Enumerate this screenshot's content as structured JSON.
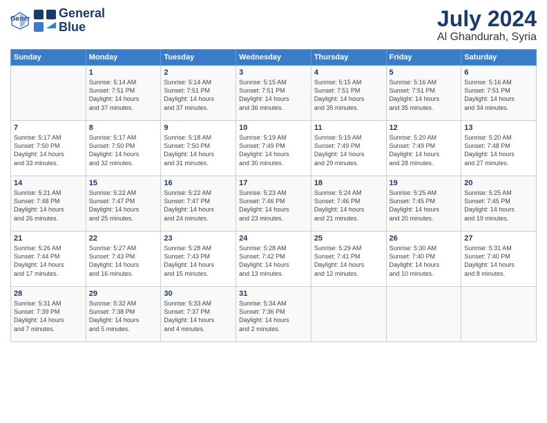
{
  "header": {
    "logo_line1": "General",
    "logo_line2": "Blue",
    "month": "July 2024",
    "location": "Al Ghandurah, Syria"
  },
  "weekdays": [
    "Sunday",
    "Monday",
    "Tuesday",
    "Wednesday",
    "Thursday",
    "Friday",
    "Saturday"
  ],
  "weeks": [
    [
      {
        "day": "",
        "content": ""
      },
      {
        "day": "1",
        "content": "Sunrise: 5:14 AM\nSunset: 7:51 PM\nDaylight: 14 hours\nand 37 minutes."
      },
      {
        "day": "2",
        "content": "Sunrise: 5:14 AM\nSunset: 7:51 PM\nDaylight: 14 hours\nand 37 minutes."
      },
      {
        "day": "3",
        "content": "Sunrise: 5:15 AM\nSunset: 7:51 PM\nDaylight: 14 hours\nand 36 minutes."
      },
      {
        "day": "4",
        "content": "Sunrise: 5:15 AM\nSunset: 7:51 PM\nDaylight: 14 hours\nand 35 minutes."
      },
      {
        "day": "5",
        "content": "Sunrise: 5:16 AM\nSunset: 7:51 PM\nDaylight: 14 hours\nand 35 minutes."
      },
      {
        "day": "6",
        "content": "Sunrise: 5:16 AM\nSunset: 7:51 PM\nDaylight: 14 hours\nand 34 minutes."
      }
    ],
    [
      {
        "day": "7",
        "content": "Sunrise: 5:17 AM\nSunset: 7:50 PM\nDaylight: 14 hours\nand 33 minutes."
      },
      {
        "day": "8",
        "content": "Sunrise: 5:17 AM\nSunset: 7:50 PM\nDaylight: 14 hours\nand 32 minutes."
      },
      {
        "day": "9",
        "content": "Sunrise: 5:18 AM\nSunset: 7:50 PM\nDaylight: 14 hours\nand 31 minutes."
      },
      {
        "day": "10",
        "content": "Sunrise: 5:19 AM\nSunset: 7:49 PM\nDaylight: 14 hours\nand 30 minutes."
      },
      {
        "day": "11",
        "content": "Sunrise: 5:19 AM\nSunset: 7:49 PM\nDaylight: 14 hours\nand 29 minutes."
      },
      {
        "day": "12",
        "content": "Sunrise: 5:20 AM\nSunset: 7:49 PM\nDaylight: 14 hours\nand 28 minutes."
      },
      {
        "day": "13",
        "content": "Sunrise: 5:20 AM\nSunset: 7:48 PM\nDaylight: 14 hours\nand 27 minutes."
      }
    ],
    [
      {
        "day": "14",
        "content": "Sunrise: 5:21 AM\nSunset: 7:48 PM\nDaylight: 14 hours\nand 26 minutes."
      },
      {
        "day": "15",
        "content": "Sunrise: 5:22 AM\nSunset: 7:47 PM\nDaylight: 14 hours\nand 25 minutes."
      },
      {
        "day": "16",
        "content": "Sunrise: 5:22 AM\nSunset: 7:47 PM\nDaylight: 14 hours\nand 24 minutes."
      },
      {
        "day": "17",
        "content": "Sunrise: 5:23 AM\nSunset: 7:46 PM\nDaylight: 14 hours\nand 23 minutes."
      },
      {
        "day": "18",
        "content": "Sunrise: 5:24 AM\nSunset: 7:46 PM\nDaylight: 14 hours\nand 21 minutes."
      },
      {
        "day": "19",
        "content": "Sunrise: 5:25 AM\nSunset: 7:45 PM\nDaylight: 14 hours\nand 20 minutes."
      },
      {
        "day": "20",
        "content": "Sunrise: 5:25 AM\nSunset: 7:45 PM\nDaylight: 14 hours\nand 19 minutes."
      }
    ],
    [
      {
        "day": "21",
        "content": "Sunrise: 5:26 AM\nSunset: 7:44 PM\nDaylight: 14 hours\nand 17 minutes."
      },
      {
        "day": "22",
        "content": "Sunrise: 5:27 AM\nSunset: 7:43 PM\nDaylight: 14 hours\nand 16 minutes."
      },
      {
        "day": "23",
        "content": "Sunrise: 5:28 AM\nSunset: 7:43 PM\nDaylight: 14 hours\nand 15 minutes."
      },
      {
        "day": "24",
        "content": "Sunrise: 5:28 AM\nSunset: 7:42 PM\nDaylight: 14 hours\nand 13 minutes."
      },
      {
        "day": "25",
        "content": "Sunrise: 5:29 AM\nSunset: 7:41 PM\nDaylight: 14 hours\nand 12 minutes."
      },
      {
        "day": "26",
        "content": "Sunrise: 5:30 AM\nSunset: 7:40 PM\nDaylight: 14 hours\nand 10 minutes."
      },
      {
        "day": "27",
        "content": "Sunrise: 5:31 AM\nSunset: 7:40 PM\nDaylight: 14 hours\nand 8 minutes."
      }
    ],
    [
      {
        "day": "28",
        "content": "Sunrise: 5:31 AM\nSunset: 7:39 PM\nDaylight: 14 hours\nand 7 minutes."
      },
      {
        "day": "29",
        "content": "Sunrise: 5:32 AM\nSunset: 7:38 PM\nDaylight: 14 hours\nand 5 minutes."
      },
      {
        "day": "30",
        "content": "Sunrise: 5:33 AM\nSunset: 7:37 PM\nDaylight: 14 hours\nand 4 minutes."
      },
      {
        "day": "31",
        "content": "Sunrise: 5:34 AM\nSunset: 7:36 PM\nDaylight: 14 hours\nand 2 minutes."
      },
      {
        "day": "",
        "content": ""
      },
      {
        "day": "",
        "content": ""
      },
      {
        "day": "",
        "content": ""
      }
    ]
  ]
}
